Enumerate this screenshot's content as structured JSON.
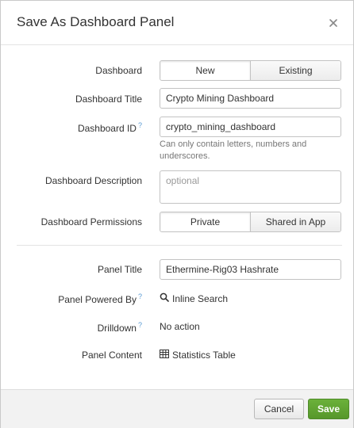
{
  "dialog": {
    "title": "Save As Dashboard Panel"
  },
  "form": {
    "dashboard": {
      "label": "Dashboard",
      "options": [
        "New",
        "Existing"
      ],
      "selected": "New"
    },
    "dashboard_title": {
      "label": "Dashboard Title",
      "value": "Crypto Mining Dashboard"
    },
    "dashboard_id": {
      "label": "Dashboard ID",
      "help_mark": "?",
      "value": "crypto_mining_dashboard",
      "help_text": "Can only contain letters, numbers and underscores."
    },
    "dashboard_description": {
      "label": "Dashboard Description",
      "placeholder": "optional",
      "value": ""
    },
    "dashboard_permissions": {
      "label": "Dashboard Permissions",
      "options": [
        "Private",
        "Shared in App"
      ],
      "selected": "Private"
    },
    "panel_title": {
      "label": "Panel Title",
      "value": "Ethermine-Rig03 Hashrate"
    },
    "panel_powered_by": {
      "label": "Panel Powered By",
      "help_mark": "?",
      "value": "Inline Search",
      "icon": "search-icon"
    },
    "drilldown": {
      "label": "Drilldown",
      "help_mark": "?",
      "value": "No action"
    },
    "panel_content": {
      "label": "Panel Content",
      "value": "Statistics Table",
      "icon": "table-icon"
    }
  },
  "footer": {
    "cancel_label": "Cancel",
    "save_label": "Save"
  },
  "colors": {
    "save_button": "#5fa332",
    "help_mark": "#5a9bd4"
  }
}
